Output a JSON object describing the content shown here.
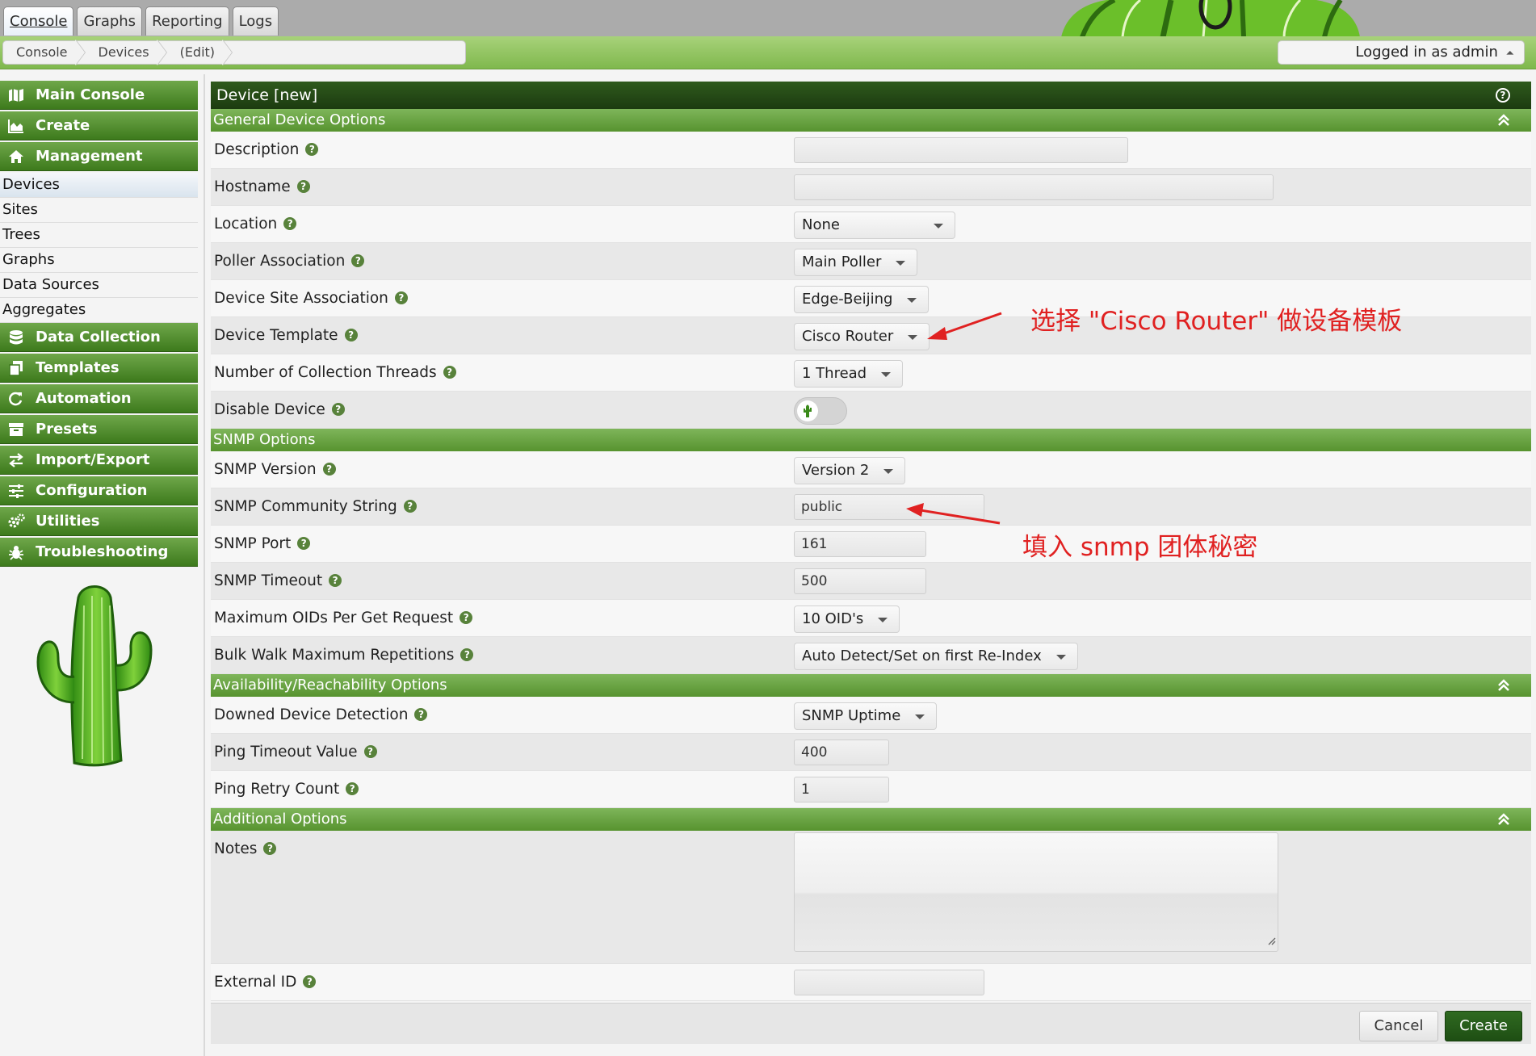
{
  "tabs": [
    "Console",
    "Graphs",
    "Reporting",
    "Logs"
  ],
  "breadcrumb": [
    "Console",
    "Devices",
    "(Edit)"
  ],
  "user": {
    "label": "Logged in as admin",
    "caret": "⏶"
  },
  "nav": {
    "main_console": "Main Console",
    "create": "Create",
    "management": "Management",
    "management_items": [
      "Devices",
      "Sites",
      "Trees",
      "Graphs",
      "Data Sources",
      "Aggregates"
    ],
    "data_collection": "Data Collection",
    "templates": "Templates",
    "automation": "Automation",
    "presets": "Presets",
    "import_export": "Import/Export",
    "configuration": "Configuration",
    "utilities": "Utilities",
    "troubleshooting": "Troubleshooting"
  },
  "form": {
    "title": "Device [new]",
    "help_icon": "?",
    "help_mark": "?",
    "sections": {
      "general": "General Device Options",
      "snmp": "SNMP Options",
      "availability": "Availability/Reachability Options",
      "additional": "Additional Options"
    },
    "fields": {
      "description": {
        "label": "Description",
        "value": ""
      },
      "hostname": {
        "label": "Hostname",
        "value": ""
      },
      "location": {
        "label": "Location",
        "value": "None"
      },
      "poller": {
        "label": "Poller Association",
        "value": "Main Poller"
      },
      "site": {
        "label": "Device Site Association",
        "value": "Edge-Beijing"
      },
      "template": {
        "label": "Device Template",
        "value": "Cisco Router"
      },
      "threads": {
        "label": "Number of Collection Threads",
        "value": "1 Thread"
      },
      "disable": {
        "label": "Disable Device"
      },
      "snmp_version": {
        "label": "SNMP Version",
        "value": "Version 2"
      },
      "snmp_community": {
        "label": "SNMP Community String",
        "value": "public"
      },
      "snmp_port": {
        "label": "SNMP Port",
        "value": "161"
      },
      "snmp_timeout": {
        "label": "SNMP Timeout",
        "value": "500"
      },
      "max_oids": {
        "label": "Maximum OIDs Per Get Request",
        "value": "10 OID's"
      },
      "bulk_walk": {
        "label": "Bulk Walk Maximum Repetitions",
        "value": "Auto Detect/Set on first Re-Index"
      },
      "downed_detection": {
        "label": "Downed Device Detection",
        "value": "SNMP Uptime"
      },
      "ping_timeout": {
        "label": "Ping Timeout Value",
        "value": "400"
      },
      "ping_retry": {
        "label": "Ping Retry Count",
        "value": "1"
      },
      "notes": {
        "label": "Notes",
        "value": ""
      },
      "external_id": {
        "label": "External ID",
        "value": ""
      }
    },
    "buttons": {
      "cancel": "Cancel",
      "create": "Create"
    }
  },
  "annotations": {
    "template_note": "选择 \"Cisco Router\" 做设备模板",
    "community_note": "填入 snmp 团体秘密"
  },
  "colors": {
    "nav_green": "#4a8a27",
    "title_green": "#24461a",
    "section_green": "#6aa545",
    "annotation_red": "#e02121"
  }
}
